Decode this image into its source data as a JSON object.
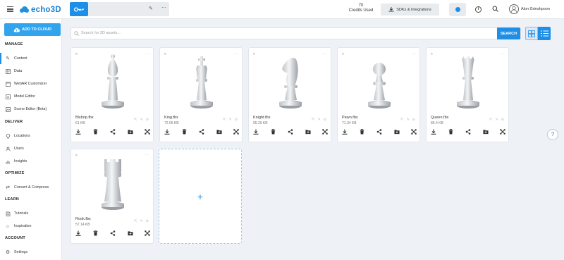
{
  "header": {
    "logo_text": "echo3D",
    "credits_count": "70",
    "credits_label": "Credits Used",
    "sdk_label": "SDKs & Integrations",
    "username": "Alon Grinshpoon"
  },
  "sidebar": {
    "add_button": "ADD TO CLOUD",
    "sections": {
      "manage": "MANAGE",
      "deliver": "DELIVER",
      "optimize": "OPTIMIZE",
      "learn": "LEARN",
      "account": "ACCOUNT"
    },
    "items": [
      {
        "label": "Content",
        "icon": "pencil-icon"
      },
      {
        "label": "Data",
        "icon": "data-icon"
      },
      {
        "label": "WebAR Customizer",
        "icon": "webar-icon"
      },
      {
        "label": "Model Editor",
        "icon": "model-editor-icon"
      },
      {
        "label": "Scene Editor (Beta)",
        "icon": "scene-editor-icon"
      },
      {
        "label": "Locations",
        "icon": "location-icon"
      },
      {
        "label": "Users",
        "icon": "users-icon"
      },
      {
        "label": "Insights",
        "icon": "insights-icon"
      },
      {
        "label": "Convert & Compress",
        "icon": "convert-icon"
      },
      {
        "label": "Tutorials",
        "icon": "tutorials-icon"
      },
      {
        "label": "Inspiration",
        "icon": "inspiration-icon"
      },
      {
        "label": "Settings",
        "icon": "settings-icon"
      }
    ]
  },
  "search": {
    "placeholder": "Search for 3D assets...",
    "button": "SEARCH"
  },
  "assets": [
    {
      "name": "Bishop.fbx",
      "size": "61 KB",
      "piece": "bishop"
    },
    {
      "name": "King.fbx",
      "size": "72.65 KB",
      "piece": "king"
    },
    {
      "name": "Knight.fbx",
      "size": "95.29 KB",
      "piece": "knight"
    },
    {
      "name": "Pawn.fbx",
      "size": "71.34 KB",
      "piece": "pawn"
    },
    {
      "name": "Queen.fbx",
      "size": "85.4 KB",
      "piece": "queen"
    },
    {
      "name": "Rook.fbx",
      "size": "57.14 KB",
      "piece": "rook"
    }
  ],
  "add_card_symbol": "+",
  "help_symbol": "?"
}
